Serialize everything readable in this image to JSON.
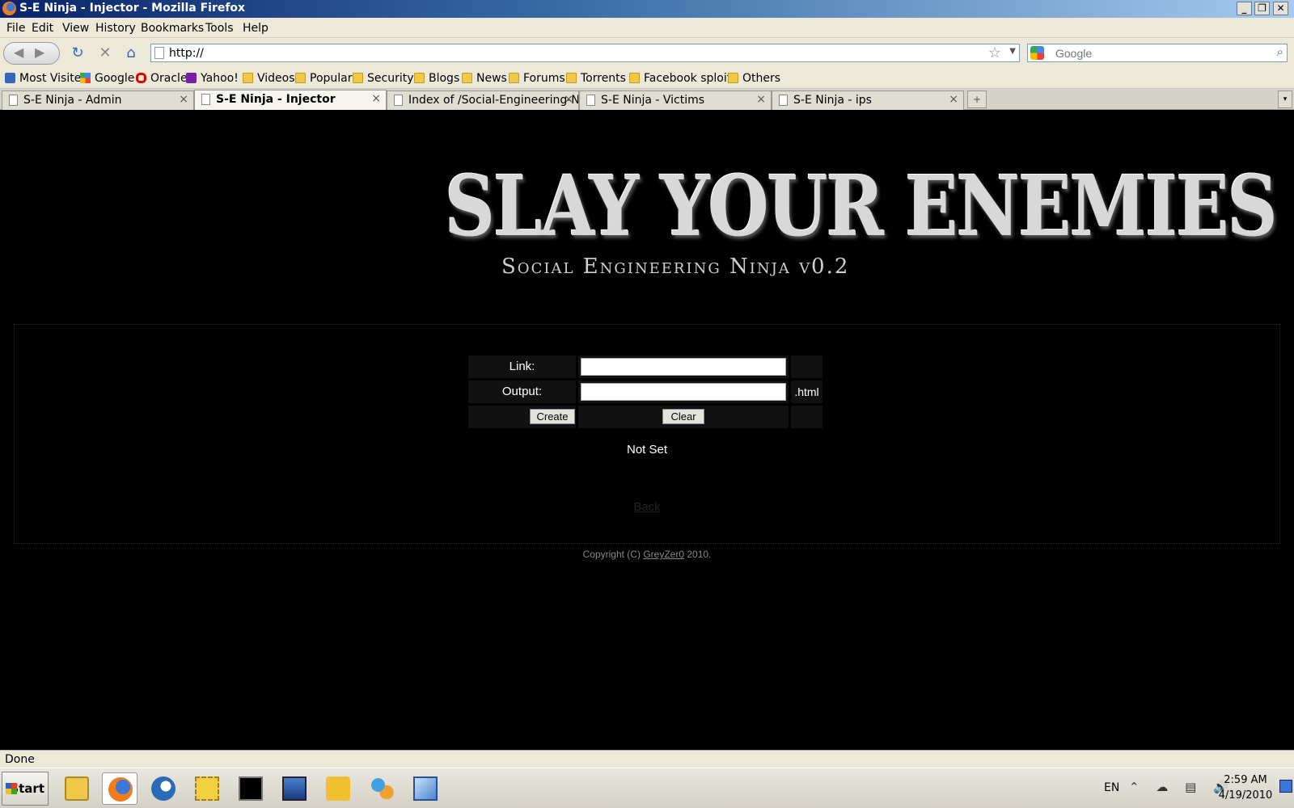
{
  "window": {
    "title": "S-E Ninja - Injector - Mozilla Firefox",
    "controls": {
      "minimize": "_",
      "maximize": "❐",
      "close": "✕"
    }
  },
  "menu": [
    "File",
    "Edit",
    "View",
    "History",
    "Bookmarks",
    "Tools",
    "Help"
  ],
  "nav": {
    "back_icon": "◀",
    "forward_icon": "▶",
    "reload_icon": "↻",
    "stop_icon": "✕",
    "home_icon": "⌂",
    "url": "http://",
    "star_icon": "☆",
    "search_placeholder": "Google",
    "search_icon": "⌕"
  },
  "bookmarks": [
    {
      "label": "Most Visited",
      "icon": "most-visited-icon"
    },
    {
      "label": "Google",
      "icon": "google-icon"
    },
    {
      "label": "Oracle",
      "icon": "oracle-icon"
    },
    {
      "label": "Yahoo!",
      "icon": "yahoo-icon"
    },
    {
      "label": "Videos",
      "icon": "folder-icon"
    },
    {
      "label": "Popular",
      "icon": "folder-icon"
    },
    {
      "label": "Security",
      "icon": "folder-icon"
    },
    {
      "label": "Blogs",
      "icon": "folder-icon"
    },
    {
      "label": "News",
      "icon": "folder-icon"
    },
    {
      "label": "Forums",
      "icon": "folder-icon"
    },
    {
      "label": "Torrents",
      "icon": "folder-icon"
    },
    {
      "label": "Facebook sploits",
      "icon": "folder-icon"
    },
    {
      "label": "Others",
      "icon": "folder-icon"
    }
  ],
  "tabs": [
    {
      "label": "S-E Ninja - Admin",
      "active": false
    },
    {
      "label": "S-E Ninja - Injector",
      "active": true
    },
    {
      "label": "Index of /Social-Engineering-Ni...",
      "active": false
    },
    {
      "label": "S-E Ninja - Victims",
      "active": false
    },
    {
      "label": "S-E Ninja - ips",
      "active": false
    }
  ],
  "tab_close": "×",
  "new_tab": "+",
  "tab_list": "▾",
  "page": {
    "logo_title": "SLAY YOUR ENEMIES",
    "logo_subtitle": "Social Engineering Ninja v0.2",
    "form": {
      "link_label": "Link:",
      "link_value": "",
      "output_label": "Output:",
      "output_value": "",
      "output_suffix": ".html",
      "create_button": "Create",
      "clear_button": "Clear"
    },
    "status_message": "Not Set",
    "back_link": "Back",
    "copyright_prefix": "Copyright (C)",
    "copyright_author": "GreyZer0",
    "copyright_year": "2010."
  },
  "statusbar": {
    "text": "Done"
  },
  "taskbar": {
    "start_label": "Start",
    "apps": [
      "explorer-icon",
      "firefox-icon",
      "thunderbird-icon",
      "network-icon",
      "cmd-icon",
      "remote-desktop-icon",
      "bird-icon",
      "users-icon",
      "cube-icon"
    ],
    "language": "EN",
    "tray": "⌃ ☁ ▤ 🔊",
    "time": "2:59 AM",
    "date": "4/19/2010"
  },
  "colors": {
    "page_background": "#000000",
    "chrome": "#ece9d8",
    "title_gradient_start": "#0a246a",
    "text_white": "#ffffff",
    "form_cell": "#111111"
  }
}
